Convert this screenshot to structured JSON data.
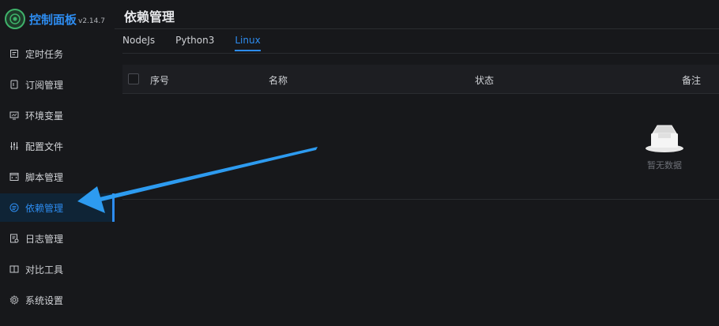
{
  "brand": {
    "title": "控制面板",
    "version": "v2.14.7"
  },
  "sidebar": {
    "items": [
      {
        "label": "定时任务",
        "icon": "schedule-icon",
        "active": false
      },
      {
        "label": "订阅管理",
        "icon": "subscription-icon",
        "active": false
      },
      {
        "label": "环境变量",
        "icon": "monitor-icon",
        "active": false
      },
      {
        "label": "配置文件",
        "icon": "sliders-icon",
        "active": false
      },
      {
        "label": "脚本管理",
        "icon": "code-icon",
        "active": false
      },
      {
        "label": "依赖管理",
        "icon": "package-icon",
        "active": true
      },
      {
        "label": "日志管理",
        "icon": "log-icon",
        "active": false
      },
      {
        "label": "对比工具",
        "icon": "diff-icon",
        "active": false
      },
      {
        "label": "系统设置",
        "icon": "gear-icon",
        "active": false
      }
    ]
  },
  "main": {
    "title": "依赖管理",
    "tabs": [
      {
        "label": "NodeJs",
        "active": false
      },
      {
        "label": "Python3",
        "active": false
      },
      {
        "label": "Linux",
        "active": true
      }
    ],
    "table": {
      "columns": [
        "序号",
        "名称",
        "状态",
        "备注"
      ],
      "empty_text": "暂无数据"
    }
  },
  "colors": {
    "accent": "#2d8cf0",
    "background": "#17181b",
    "annotation_arrow": "#2d9bf0"
  }
}
